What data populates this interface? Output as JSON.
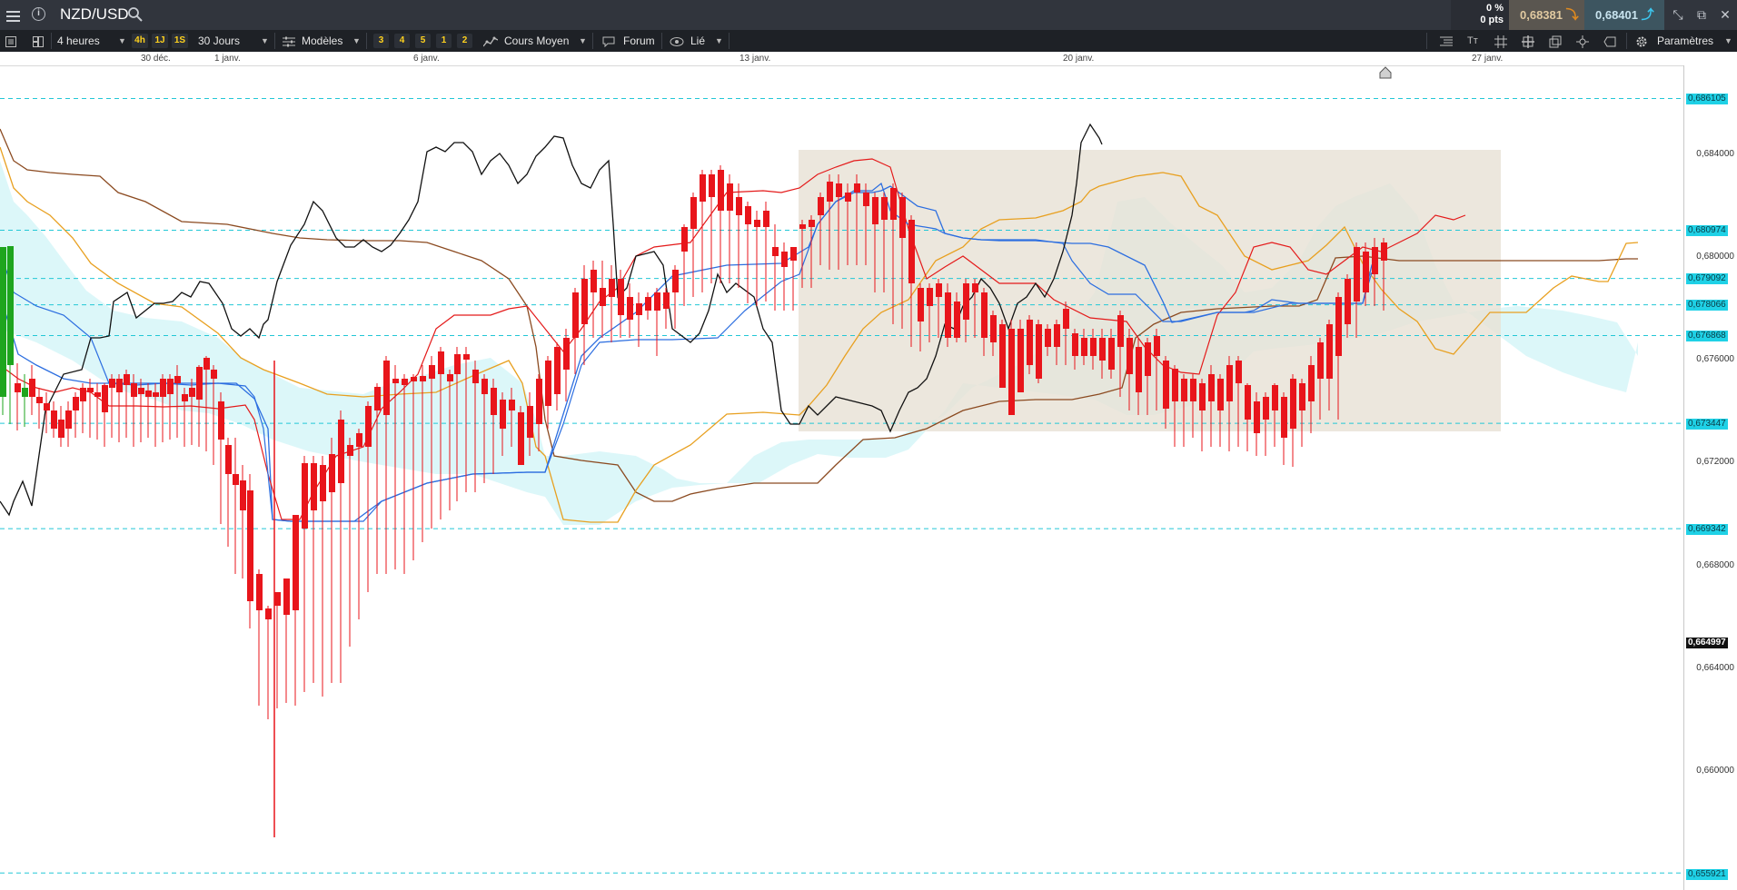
{
  "header": {
    "symbol": "NZD/USD",
    "change_pct": "0 %",
    "change_pts": "0 pts",
    "bid": "0,68381",
    "ask": "0,68401"
  },
  "toolbar": {
    "timeframe": "4 heures",
    "chips": [
      "4h",
      "1J",
      "1S"
    ],
    "range": "30 Jours",
    "models": "Modèles",
    "model_chips": [
      "3",
      "4",
      "5",
      "1",
      "2"
    ],
    "indicator": "Cours Moyen",
    "forum": "Forum",
    "link": "Lié",
    "settings": "Paramètres"
  },
  "time_axis": {
    "labels": [
      "30 déc.",
      "1 janv.",
      "6 janv.",
      "13 janv.",
      "20 janv.",
      "27 janv."
    ]
  },
  "price_axis": {
    "ticks": [
      "0,684000",
      "0,680000",
      "0,676000",
      "0,672000",
      "0,668000",
      "0,664000",
      "0,660000"
    ],
    "levels": [
      "0,686105",
      "0,680974",
      "0,679092",
      "0,678066",
      "0,676868",
      "0,673447",
      "0,669342",
      "0,655921"
    ],
    "current": "0,664997"
  },
  "chart_data": {
    "type": "candlestick",
    "instrument": "NZD/USD",
    "timeframe": "4 heures",
    "indicator": "Ichimoku",
    "x_labels": [
      "30 déc.",
      "1 janv.",
      "6 janv.",
      "13 janv.",
      "20 janv.",
      "27 janv."
    ],
    "y_range": [
      0.6555,
      0.6873
    ],
    "horizontal_levels": [
      0.686105,
      0.680974,
      0.679092,
      0.678066,
      0.676868,
      0.673447,
      0.669342,
      0.655921
    ],
    "current_price_label": 0.664997,
    "colors": {
      "bull": "#1ea51e",
      "bear": "#e8151b",
      "tenkan": "#e41a1a",
      "kijun": "#2c6ee0",
      "chikou": "#111111",
      "span_a": "#e8a020",
      "span_b": "#8b4a20",
      "cloud": "#d8f6f8",
      "levels": "#22c7d6",
      "range_box": "#e8e2d6"
    }
  }
}
